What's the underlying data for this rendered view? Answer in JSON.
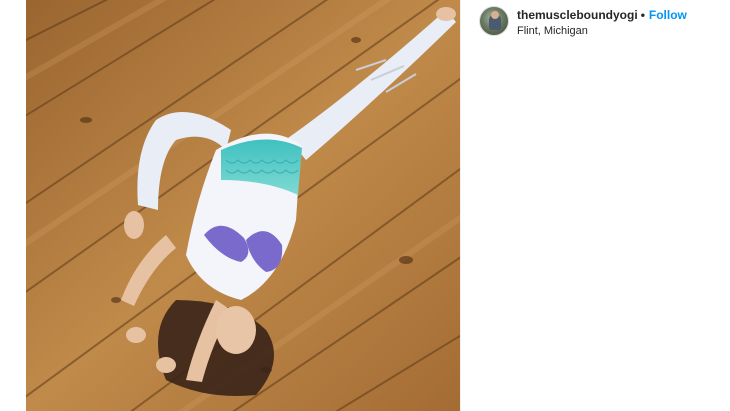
{
  "post": {
    "header": {
      "username": "themuscleboundyogi",
      "separator": "•",
      "follow_label": "Follow",
      "location": "Flint, Michigan"
    },
    "photo": {
      "subject": "woman in mermaid-print leggings and top doing a split stretch on a wooden floor"
    },
    "colors": {
      "follow": "#0095f6",
      "text": "#262626",
      "floor": "#b07a3e"
    },
    "icons": {
      "avatar": "profile-avatar"
    }
  }
}
